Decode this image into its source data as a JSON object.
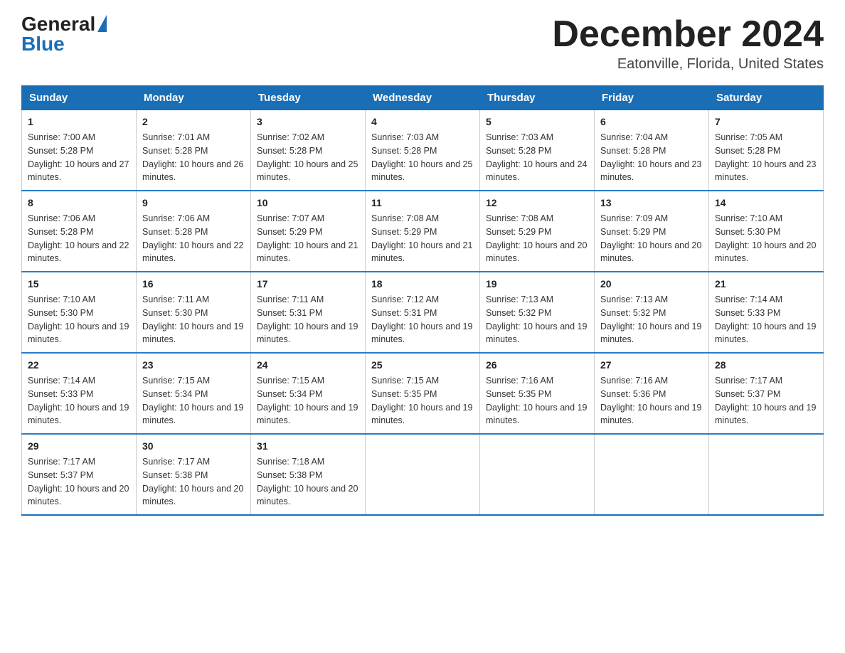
{
  "header": {
    "logo_general": "General",
    "logo_blue": "Blue",
    "month_title": "December 2024",
    "location": "Eatonville, Florida, United States"
  },
  "days_of_week": [
    "Sunday",
    "Monday",
    "Tuesday",
    "Wednesday",
    "Thursday",
    "Friday",
    "Saturday"
  ],
  "weeks": [
    [
      {
        "day": "1",
        "sunrise": "7:00 AM",
        "sunset": "5:28 PM",
        "daylight": "10 hours and 27 minutes."
      },
      {
        "day": "2",
        "sunrise": "7:01 AM",
        "sunset": "5:28 PM",
        "daylight": "10 hours and 26 minutes."
      },
      {
        "day": "3",
        "sunrise": "7:02 AM",
        "sunset": "5:28 PM",
        "daylight": "10 hours and 25 minutes."
      },
      {
        "day": "4",
        "sunrise": "7:03 AM",
        "sunset": "5:28 PM",
        "daylight": "10 hours and 25 minutes."
      },
      {
        "day": "5",
        "sunrise": "7:03 AM",
        "sunset": "5:28 PM",
        "daylight": "10 hours and 24 minutes."
      },
      {
        "day": "6",
        "sunrise": "7:04 AM",
        "sunset": "5:28 PM",
        "daylight": "10 hours and 23 minutes."
      },
      {
        "day": "7",
        "sunrise": "7:05 AM",
        "sunset": "5:28 PM",
        "daylight": "10 hours and 23 minutes."
      }
    ],
    [
      {
        "day": "8",
        "sunrise": "7:06 AM",
        "sunset": "5:28 PM",
        "daylight": "10 hours and 22 minutes."
      },
      {
        "day": "9",
        "sunrise": "7:06 AM",
        "sunset": "5:28 PM",
        "daylight": "10 hours and 22 minutes."
      },
      {
        "day": "10",
        "sunrise": "7:07 AM",
        "sunset": "5:29 PM",
        "daylight": "10 hours and 21 minutes."
      },
      {
        "day": "11",
        "sunrise": "7:08 AM",
        "sunset": "5:29 PM",
        "daylight": "10 hours and 21 minutes."
      },
      {
        "day": "12",
        "sunrise": "7:08 AM",
        "sunset": "5:29 PM",
        "daylight": "10 hours and 20 minutes."
      },
      {
        "day": "13",
        "sunrise": "7:09 AM",
        "sunset": "5:29 PM",
        "daylight": "10 hours and 20 minutes."
      },
      {
        "day": "14",
        "sunrise": "7:10 AM",
        "sunset": "5:30 PM",
        "daylight": "10 hours and 20 minutes."
      }
    ],
    [
      {
        "day": "15",
        "sunrise": "7:10 AM",
        "sunset": "5:30 PM",
        "daylight": "10 hours and 19 minutes."
      },
      {
        "day": "16",
        "sunrise": "7:11 AM",
        "sunset": "5:30 PM",
        "daylight": "10 hours and 19 minutes."
      },
      {
        "day": "17",
        "sunrise": "7:11 AM",
        "sunset": "5:31 PM",
        "daylight": "10 hours and 19 minutes."
      },
      {
        "day": "18",
        "sunrise": "7:12 AM",
        "sunset": "5:31 PM",
        "daylight": "10 hours and 19 minutes."
      },
      {
        "day": "19",
        "sunrise": "7:13 AM",
        "sunset": "5:32 PM",
        "daylight": "10 hours and 19 minutes."
      },
      {
        "day": "20",
        "sunrise": "7:13 AM",
        "sunset": "5:32 PM",
        "daylight": "10 hours and 19 minutes."
      },
      {
        "day": "21",
        "sunrise": "7:14 AM",
        "sunset": "5:33 PM",
        "daylight": "10 hours and 19 minutes."
      }
    ],
    [
      {
        "day": "22",
        "sunrise": "7:14 AM",
        "sunset": "5:33 PM",
        "daylight": "10 hours and 19 minutes."
      },
      {
        "day": "23",
        "sunrise": "7:15 AM",
        "sunset": "5:34 PM",
        "daylight": "10 hours and 19 minutes."
      },
      {
        "day": "24",
        "sunrise": "7:15 AM",
        "sunset": "5:34 PM",
        "daylight": "10 hours and 19 minutes."
      },
      {
        "day": "25",
        "sunrise": "7:15 AM",
        "sunset": "5:35 PM",
        "daylight": "10 hours and 19 minutes."
      },
      {
        "day": "26",
        "sunrise": "7:16 AM",
        "sunset": "5:35 PM",
        "daylight": "10 hours and 19 minutes."
      },
      {
        "day": "27",
        "sunrise": "7:16 AM",
        "sunset": "5:36 PM",
        "daylight": "10 hours and 19 minutes."
      },
      {
        "day": "28",
        "sunrise": "7:17 AM",
        "sunset": "5:37 PM",
        "daylight": "10 hours and 19 minutes."
      }
    ],
    [
      {
        "day": "29",
        "sunrise": "7:17 AM",
        "sunset": "5:37 PM",
        "daylight": "10 hours and 20 minutes."
      },
      {
        "day": "30",
        "sunrise": "7:17 AM",
        "sunset": "5:38 PM",
        "daylight": "10 hours and 20 minutes."
      },
      {
        "day": "31",
        "sunrise": "7:18 AM",
        "sunset": "5:38 PM",
        "daylight": "10 hours and 20 minutes."
      },
      {
        "day": "",
        "sunrise": "",
        "sunset": "",
        "daylight": ""
      },
      {
        "day": "",
        "sunrise": "",
        "sunset": "",
        "daylight": ""
      },
      {
        "day": "",
        "sunrise": "",
        "sunset": "",
        "daylight": ""
      },
      {
        "day": "",
        "sunrise": "",
        "sunset": "",
        "daylight": ""
      }
    ]
  ]
}
